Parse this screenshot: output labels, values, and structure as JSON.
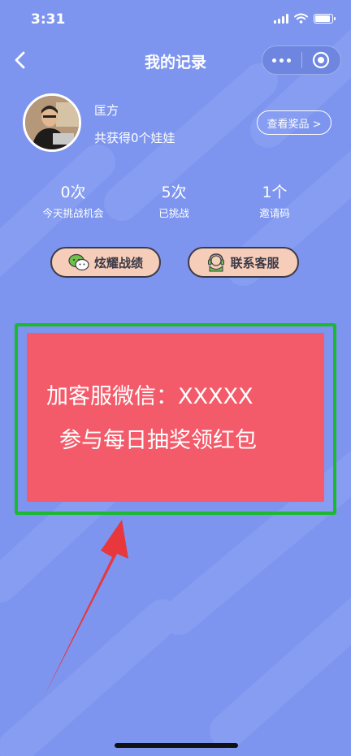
{
  "status_bar": {
    "time": "3:31"
  },
  "nav": {
    "title": "我的记录"
  },
  "profile": {
    "name": "匡方",
    "subtitle": "共获得0个娃娃",
    "prize_button": "查看奖品 >"
  },
  "stats": [
    {
      "value": "0次",
      "label": "今天挑战机会"
    },
    {
      "value": "5次",
      "label": "已挑战"
    },
    {
      "value": "1个",
      "label": "邀请码"
    }
  ],
  "actions": {
    "show_off": "炫耀战绩",
    "contact": "联系客服"
  },
  "banner": {
    "line1": "加客服微信：XXXXX",
    "line2": "参与每日抽奖领红包"
  },
  "colors": {
    "background": "#7d95ef",
    "banner": "#f45b6a",
    "highlight_border": "#1bb830",
    "pill_bg": "#f6cdb8",
    "arrow": "#e8373d"
  },
  "icons": [
    "back-icon",
    "more-icon",
    "target-icon",
    "wechat-icon",
    "headset-icon"
  ]
}
